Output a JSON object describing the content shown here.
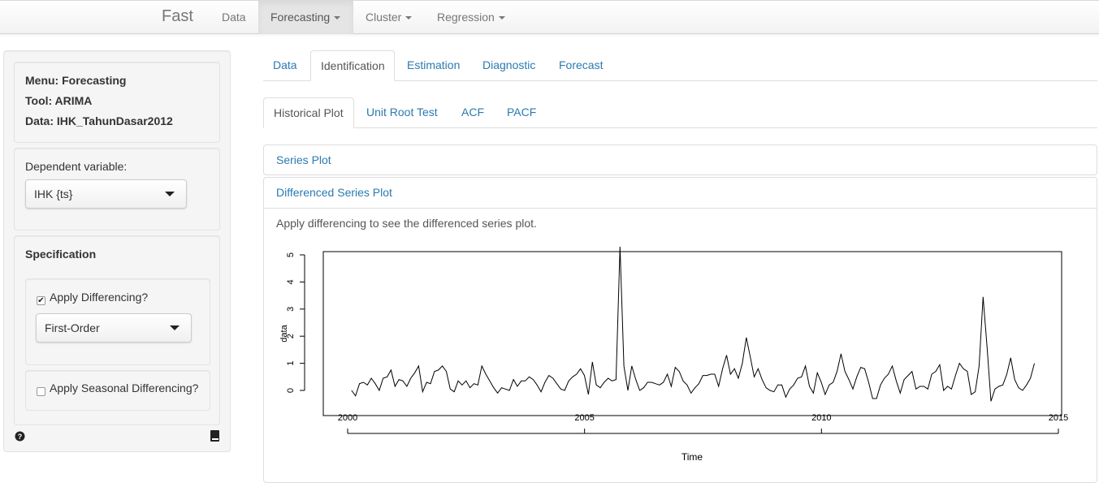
{
  "navbar": {
    "brand": "Fast",
    "items": [
      {
        "label": "Data"
      },
      {
        "label": "Forecasting"
      },
      {
        "label": "Cluster"
      },
      {
        "label": "Regression"
      }
    ]
  },
  "sidebar": {
    "menu_line": "Menu: Forecasting",
    "tool_line": "Tool: ARIMA",
    "data_line": "Data: IHK_TahunDasar2012",
    "dependent_label": "Dependent variable:",
    "dependent_value": "IHK {ts}",
    "spec_title": "Specification",
    "apply_diff_label": "Apply Differencing?",
    "apply_diff_checked": true,
    "diff_order_value": "First-Order",
    "apply_seasonal_label": "Apply Seasonal Differencing?",
    "apply_seasonal_checked": false,
    "help_icon": "question-circle-icon",
    "book_icon": "book-icon"
  },
  "main_tabs": [
    {
      "label": "Data"
    },
    {
      "label": "Identification"
    },
    {
      "label": "Estimation"
    },
    {
      "label": "Diagnostic"
    },
    {
      "label": "Forecast"
    }
  ],
  "sub_tabs": [
    {
      "label": "Historical Plot"
    },
    {
      "label": "Unit Root Test"
    },
    {
      "label": "ACF"
    },
    {
      "label": "PACF"
    }
  ],
  "panels": {
    "series_plot_title": "Series Plot",
    "diff_plot_title": "Differenced Series Plot",
    "diff_plot_message": "Apply differencing to see the differenced series plot."
  },
  "chart_data": {
    "type": "line",
    "title": "",
    "xlabel": "Time",
    "ylabel": "data",
    "xlim": [
      2000,
      2015
    ],
    "ylim": [
      0,
      5
    ],
    "x_ticks": [
      "2000",
      "2005",
      "2010",
      "2015"
    ],
    "y_ticks": [
      "0",
      "1",
      "2",
      "3",
      "4",
      "5"
    ],
    "series": [
      {
        "x_start": 2000.083,
        "x_step": 0.0833,
        "values": [
          0.0,
          -0.2,
          0.25,
          0.3,
          0.2,
          0.45,
          0.25,
          0.0,
          0.45,
          0.5,
          0.75,
          0.15,
          0.4,
          0.35,
          0.15,
          0.45,
          0.65,
          0.9,
          -0.05,
          0.3,
          0.25,
          0.7,
          0.75,
          0.9,
          0.7,
          0.05,
          -0.05,
          0.35,
          0.2,
          0.35,
          0.1,
          0.25,
          0.2,
          0.9,
          0.6,
          0.35,
          0.1,
          -0.1,
          0.1,
          0.05,
          0.0,
          0.4,
          0.15,
          0.35,
          0.35,
          0.5,
          0.4,
          0.2,
          -0.05,
          0.3,
          0.55,
          0.45,
          0.25,
          0.05,
          0.0,
          0.35,
          0.5,
          0.6,
          0.8,
          0.55,
          -0.15,
          1.05,
          0.2,
          0.1,
          0.3,
          0.45,
          0.35,
          0.4,
          5.3,
          0.9,
          0.0,
          0.9,
          0.4,
          0.0,
          0.1,
          0.3,
          0.3,
          0.25,
          0.2,
          0.3,
          0.6,
          0.15,
          0.85,
          0.7,
          0.35,
          0.2,
          -0.1,
          0.1,
          0.25,
          0.55,
          0.55,
          0.6,
          0.6,
          0.15,
          0.8,
          1.3,
          0.6,
          0.8,
          0.45,
          1.0,
          1.95,
          1.25,
          0.5,
          0.8,
          0.4,
          0.1,
          0.0,
          -0.05,
          0.2,
          0.2,
          -0.25,
          0.05,
          0.2,
          0.45,
          0.5,
          0.9,
          0.15,
          -0.1,
          0.65,
          0.3,
          -0.15,
          0.2,
          0.3,
          0.7,
          1.35,
          0.7,
          0.4,
          0.05,
          0.5,
          0.85,
          0.8,
          0.3,
          -0.3,
          -0.3,
          0.2,
          0.45,
          0.6,
          0.9,
          0.35,
          -0.1,
          0.4,
          0.55,
          0.7,
          0.05,
          0.15,
          0.15,
          0.05,
          0.6,
          0.7,
          0.95,
          0.0,
          0.15,
          0.05,
          0.55,
          1.0,
          0.8,
          0.7,
          -0.15,
          -0.05,
          0.9,
          3.45,
          1.6,
          -0.4,
          0.05,
          0.15,
          0.2,
          0.6,
          1.2,
          0.4,
          0.1,
          0.0,
          0.2,
          0.45,
          1.0
        ]
      }
    ],
    "grid": false
  }
}
